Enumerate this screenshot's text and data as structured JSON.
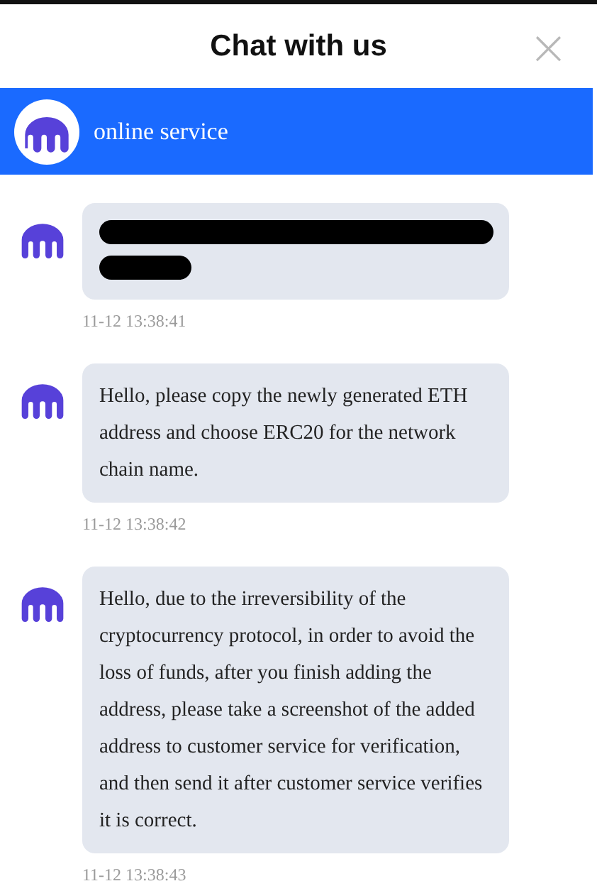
{
  "header": {
    "title": "Chat with us",
    "close": "×"
  },
  "agent_bar": {
    "name": "online service"
  },
  "messages": [
    {
      "kind": "redacted",
      "time": "11-12 13:38:41"
    },
    {
      "kind": "text",
      "text": "Hello, please copy the newly generated ETH address and choose ERC20 for the network chain name.",
      "time": "11-12 13:38:42"
    },
    {
      "kind": "text",
      "text": "Hello, due to the irreversibility of the cryptocurrency protocol, in order to avoid the loss of funds, after you finish adding the address, please take a screenshot of the added address to customer service for verification, and then send it after customer service verifies it is correct.",
      "time": "11-12 13:38:43"
    }
  ]
}
